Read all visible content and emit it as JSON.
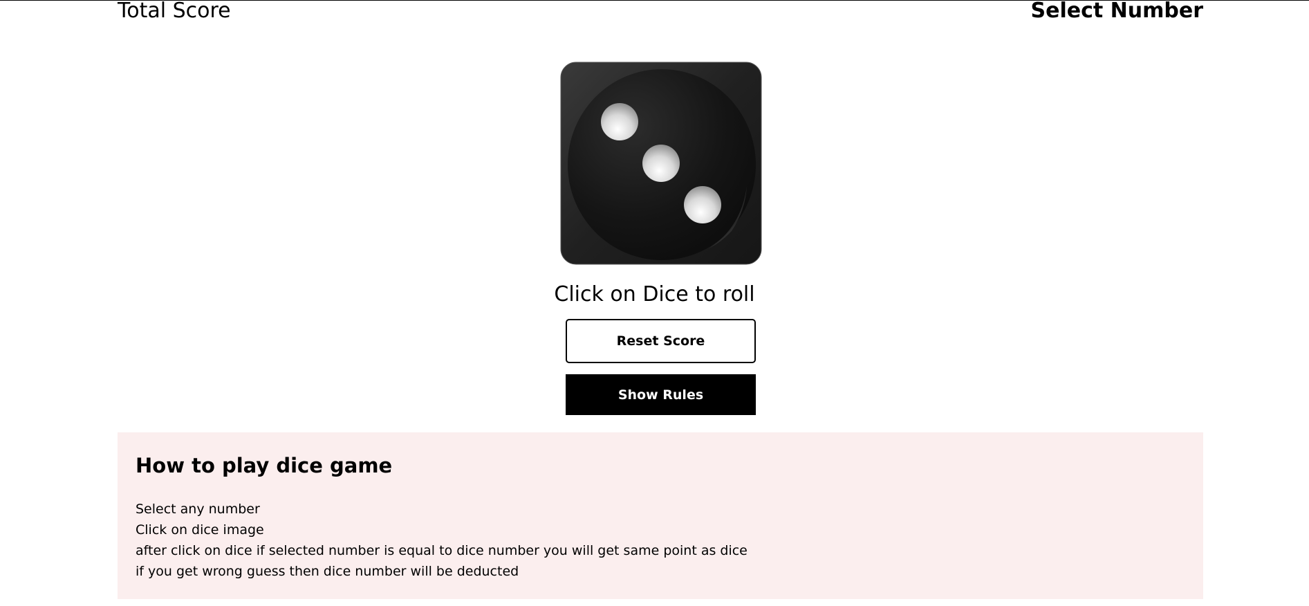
{
  "header": {
    "total_score_label": "Total Score",
    "select_number_label": "Select Number"
  },
  "dice": {
    "icon": "dice-three-icon",
    "face_value": 3,
    "body_color": "#1b1b1b",
    "pip_color": "#e6e6e6"
  },
  "hint": "Click on Dice to roll",
  "buttons": {
    "reset_label": "Reset Score",
    "rules_label": "Show Rules"
  },
  "rules": {
    "title": "How to play dice game",
    "lines": [
      "Select any number",
      "Click on dice image",
      "after click on dice if selected number is equal to dice number you will get same point as dice",
      "if you get wrong guess then dice number will be deducted"
    ],
    "background_color": "#fbeeee"
  }
}
